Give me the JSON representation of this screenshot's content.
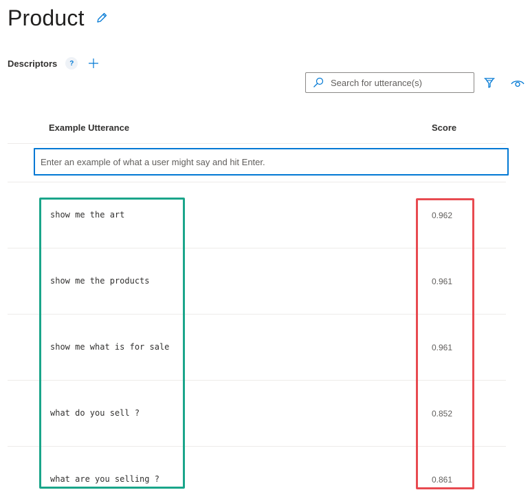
{
  "header": {
    "title": "Product",
    "edit_icon": "pencil-icon"
  },
  "descriptors": {
    "label": "Descriptors",
    "help_glyph": "?",
    "add_icon": "plus-icon"
  },
  "toolbar": {
    "search_placeholder": "Search for utterance(s)",
    "search_icon": "search-icon",
    "filter_icon": "filter-icon",
    "view_icon": "eye-icon"
  },
  "table": {
    "columns": [
      "Example Utterance",
      "Score"
    ],
    "input_placeholder": "Enter an example of what a user might say and hit Enter.",
    "rows": [
      {
        "utterance": "show me the art",
        "score": "0.962"
      },
      {
        "utterance": "show me the products",
        "score": "0.961"
      },
      {
        "utterance": "show me what is for sale",
        "score": "0.961"
      },
      {
        "utterance": "what do you sell ?",
        "score": "0.852"
      },
      {
        "utterance": "what are you selling ?",
        "score": "0.861"
      }
    ]
  },
  "colors": {
    "accent": "#0078d4",
    "highlight_utterances": "#1aa58a",
    "highlight_scores": "#e84a50"
  }
}
